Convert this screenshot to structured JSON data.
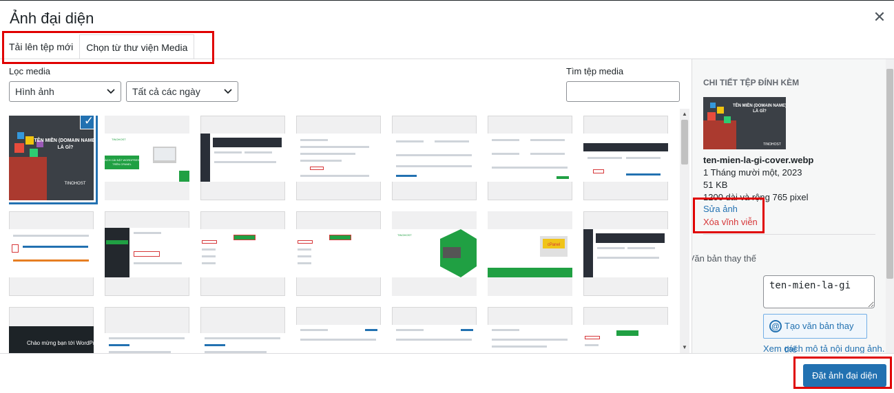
{
  "modal": {
    "title": "Ảnh đại diện",
    "close_icon": "close-icon"
  },
  "tabs": [
    {
      "label": "Tải lên tệp mới",
      "active": false
    },
    {
      "label": "Chọn từ thư viện Media",
      "active": true
    }
  ],
  "toolbar": {
    "filter_label": "Lọc media",
    "type_select": "Hình ảnh",
    "date_select": "Tất cả các ngày",
    "search_label": "Tìm tệp media",
    "search_value": ""
  },
  "thumbnails": {
    "first_title": "TÊN MIỀN (DOMAIN NAME) LÀ GÌ?",
    "first_brand": "TINOHOST",
    "second_caption": "CÁCH CÀI ĐẶT WORDPRESS TRÊN CPANEL",
    "brand": "TINOHOST",
    "welcome_text": "Chào mừng bạn tới WordPress!"
  },
  "sidebar": {
    "heading": "Chi tiết tệp đính kèm",
    "filename": "ten-mien-la-gi-cover.webp",
    "date": "1 Tháng mười một, 2023",
    "size": "51 KB",
    "dimensions": "1200 dài và rộng 765 pixel",
    "edit_link": "Sửa ảnh",
    "delete_link": "Xóa vĩnh viễn",
    "alt_label": "Văn bản thay thế",
    "alt_value": "ten-mien-la-gi",
    "ai_button": "Tạo văn bản thay thế",
    "alt_help": "Xem cách mô tả nội dung ảnh."
  },
  "footer": {
    "primary_button": "Đặt ảnh đại diện"
  },
  "colors": {
    "accent": "#2271b1",
    "highlight": "#e00000",
    "delete": "#d63638"
  }
}
